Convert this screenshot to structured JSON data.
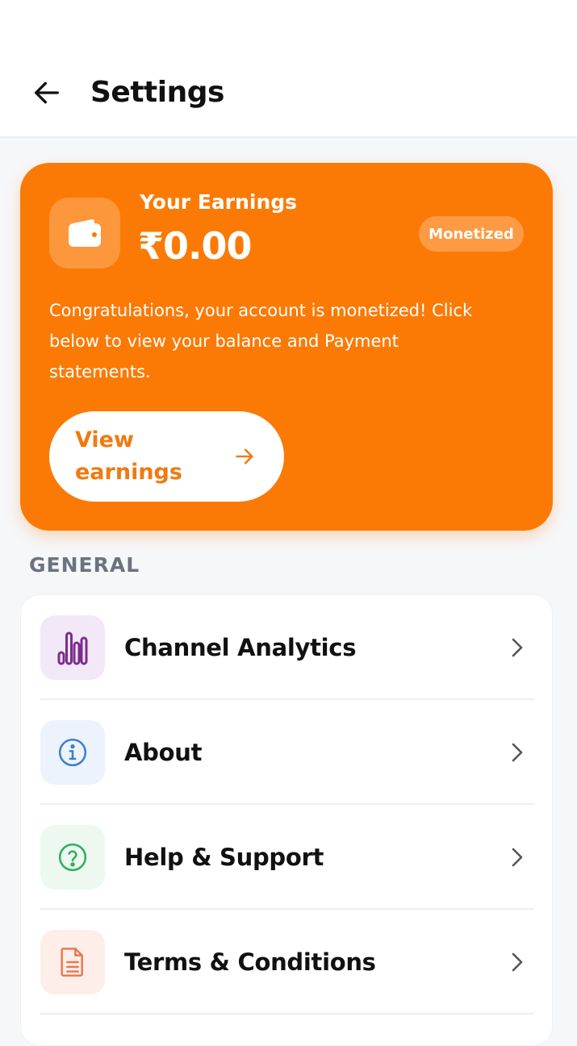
{
  "header": {
    "title": "Settings"
  },
  "earnings": {
    "label": "Your Earnings",
    "amount": "₹0.00",
    "badge": "Monetized",
    "description": "Congratulations, your account is monetized! Click below to view your balance and Payment statements.",
    "button_label": "View earnings"
  },
  "general": {
    "section_label": "GENERAL",
    "items": [
      {
        "label": "Channel Analytics",
        "icon": "bar-chart-icon",
        "tint": "#f3e8f7",
        "color": "#7b2d8e"
      },
      {
        "label": "About",
        "icon": "info-icon",
        "tint": "#edf3fc",
        "color": "#3f7fd0"
      },
      {
        "label": "Help & Support",
        "icon": "help-circle-icon",
        "tint": "#ecf8f0",
        "color": "#2fae5e"
      },
      {
        "label": "Terms & Conditions",
        "icon": "document-icon",
        "tint": "#fdeeea",
        "color": "#e77a52"
      }
    ]
  },
  "colors": {
    "accent": "#fb7a05",
    "background": "#f6f7f9"
  }
}
